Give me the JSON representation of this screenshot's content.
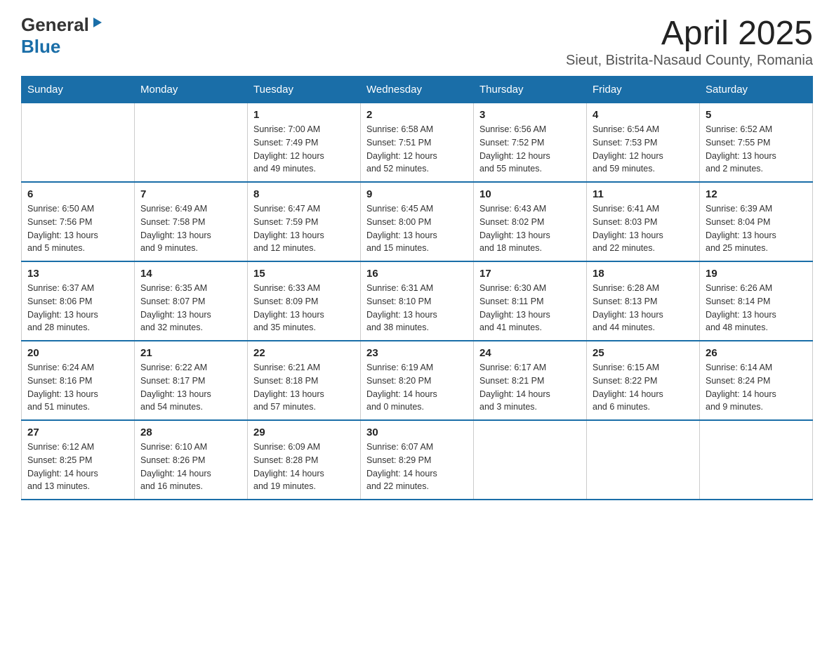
{
  "logo": {
    "general": "General",
    "blue": "Blue",
    "triangle": "▶"
  },
  "title": "April 2025",
  "subtitle": "Sieut, Bistrita-Nasaud County, Romania",
  "days_of_week": [
    "Sunday",
    "Monday",
    "Tuesday",
    "Wednesday",
    "Thursday",
    "Friday",
    "Saturday"
  ],
  "weeks": [
    [
      {
        "day": "",
        "info": ""
      },
      {
        "day": "",
        "info": ""
      },
      {
        "day": "1",
        "info": "Sunrise: 7:00 AM\nSunset: 7:49 PM\nDaylight: 12 hours\nand 49 minutes."
      },
      {
        "day": "2",
        "info": "Sunrise: 6:58 AM\nSunset: 7:51 PM\nDaylight: 12 hours\nand 52 minutes."
      },
      {
        "day": "3",
        "info": "Sunrise: 6:56 AM\nSunset: 7:52 PM\nDaylight: 12 hours\nand 55 minutes."
      },
      {
        "day": "4",
        "info": "Sunrise: 6:54 AM\nSunset: 7:53 PM\nDaylight: 12 hours\nand 59 minutes."
      },
      {
        "day": "5",
        "info": "Sunrise: 6:52 AM\nSunset: 7:55 PM\nDaylight: 13 hours\nand 2 minutes."
      }
    ],
    [
      {
        "day": "6",
        "info": "Sunrise: 6:50 AM\nSunset: 7:56 PM\nDaylight: 13 hours\nand 5 minutes."
      },
      {
        "day": "7",
        "info": "Sunrise: 6:49 AM\nSunset: 7:58 PM\nDaylight: 13 hours\nand 9 minutes."
      },
      {
        "day": "8",
        "info": "Sunrise: 6:47 AM\nSunset: 7:59 PM\nDaylight: 13 hours\nand 12 minutes."
      },
      {
        "day": "9",
        "info": "Sunrise: 6:45 AM\nSunset: 8:00 PM\nDaylight: 13 hours\nand 15 minutes."
      },
      {
        "day": "10",
        "info": "Sunrise: 6:43 AM\nSunset: 8:02 PM\nDaylight: 13 hours\nand 18 minutes."
      },
      {
        "day": "11",
        "info": "Sunrise: 6:41 AM\nSunset: 8:03 PM\nDaylight: 13 hours\nand 22 minutes."
      },
      {
        "day": "12",
        "info": "Sunrise: 6:39 AM\nSunset: 8:04 PM\nDaylight: 13 hours\nand 25 minutes."
      }
    ],
    [
      {
        "day": "13",
        "info": "Sunrise: 6:37 AM\nSunset: 8:06 PM\nDaylight: 13 hours\nand 28 minutes."
      },
      {
        "day": "14",
        "info": "Sunrise: 6:35 AM\nSunset: 8:07 PM\nDaylight: 13 hours\nand 32 minutes."
      },
      {
        "day": "15",
        "info": "Sunrise: 6:33 AM\nSunset: 8:09 PM\nDaylight: 13 hours\nand 35 minutes."
      },
      {
        "day": "16",
        "info": "Sunrise: 6:31 AM\nSunset: 8:10 PM\nDaylight: 13 hours\nand 38 minutes."
      },
      {
        "day": "17",
        "info": "Sunrise: 6:30 AM\nSunset: 8:11 PM\nDaylight: 13 hours\nand 41 minutes."
      },
      {
        "day": "18",
        "info": "Sunrise: 6:28 AM\nSunset: 8:13 PM\nDaylight: 13 hours\nand 44 minutes."
      },
      {
        "day": "19",
        "info": "Sunrise: 6:26 AM\nSunset: 8:14 PM\nDaylight: 13 hours\nand 48 minutes."
      }
    ],
    [
      {
        "day": "20",
        "info": "Sunrise: 6:24 AM\nSunset: 8:16 PM\nDaylight: 13 hours\nand 51 minutes."
      },
      {
        "day": "21",
        "info": "Sunrise: 6:22 AM\nSunset: 8:17 PM\nDaylight: 13 hours\nand 54 minutes."
      },
      {
        "day": "22",
        "info": "Sunrise: 6:21 AM\nSunset: 8:18 PM\nDaylight: 13 hours\nand 57 minutes."
      },
      {
        "day": "23",
        "info": "Sunrise: 6:19 AM\nSunset: 8:20 PM\nDaylight: 14 hours\nand 0 minutes."
      },
      {
        "day": "24",
        "info": "Sunrise: 6:17 AM\nSunset: 8:21 PM\nDaylight: 14 hours\nand 3 minutes."
      },
      {
        "day": "25",
        "info": "Sunrise: 6:15 AM\nSunset: 8:22 PM\nDaylight: 14 hours\nand 6 minutes."
      },
      {
        "day": "26",
        "info": "Sunrise: 6:14 AM\nSunset: 8:24 PM\nDaylight: 14 hours\nand 9 minutes."
      }
    ],
    [
      {
        "day": "27",
        "info": "Sunrise: 6:12 AM\nSunset: 8:25 PM\nDaylight: 14 hours\nand 13 minutes."
      },
      {
        "day": "28",
        "info": "Sunrise: 6:10 AM\nSunset: 8:26 PM\nDaylight: 14 hours\nand 16 minutes."
      },
      {
        "day": "29",
        "info": "Sunrise: 6:09 AM\nSunset: 8:28 PM\nDaylight: 14 hours\nand 19 minutes."
      },
      {
        "day": "30",
        "info": "Sunrise: 6:07 AM\nSunset: 8:29 PM\nDaylight: 14 hours\nand 22 minutes."
      },
      {
        "day": "",
        "info": ""
      },
      {
        "day": "",
        "info": ""
      },
      {
        "day": "",
        "info": ""
      }
    ]
  ]
}
